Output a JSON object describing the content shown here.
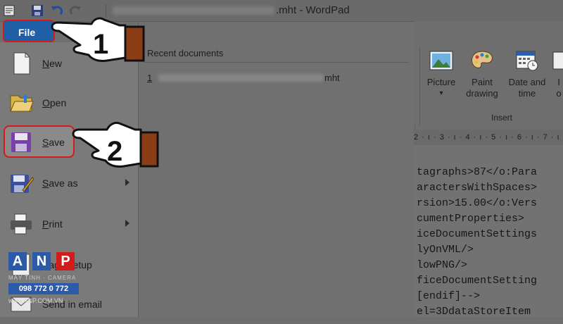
{
  "window": {
    "title_suffix": ".mht - WordPad"
  },
  "file_tab": {
    "label": "File"
  },
  "menu": {
    "items": [
      {
        "label_underline": "N",
        "label_rest": "ew"
      },
      {
        "label_underline": "O",
        "label_rest": "pen"
      },
      {
        "label_underline": "S",
        "label_rest": "ave"
      },
      {
        "label_underline": "S",
        "label_rest": "ave as"
      },
      {
        "label_underline": "P",
        "label_rest": "rint"
      },
      {
        "label_underline": "",
        "label_rest": "Page setup"
      },
      {
        "label_underline": "",
        "label_rest": "Send in email"
      }
    ]
  },
  "recent": {
    "title": "Recent documents",
    "items": [
      {
        "number": "1",
        "ext": "mht"
      }
    ]
  },
  "ribbon": {
    "buttons": [
      {
        "line1": "Picture",
        "line2": "▾"
      },
      {
        "line1": "Paint",
        "line2": "drawing"
      },
      {
        "line1": "Date and",
        "line2": "time"
      },
      {
        "line1": "I",
        "line2": "o"
      }
    ],
    "group_label": "Insert"
  },
  "ruler": {
    "text": "2 · ı · 3 · ı · 4 · ı · 5 · ı · 6 · ı · 7 · ı · 8"
  },
  "document": {
    "lines": [
      "tagraphs>87</o:Para",
      "aractersWithSpaces>",
      "rsion>15.00</o:Vers",
      "cumentProperties>",
      "iceDocumentSettings",
      "lyOnVML/>",
      "lowPNG/>",
      "ficeDocumentSetting",
      " [endif]-->",
      "el=3DdataStoreItem "
    ]
  },
  "steps": {
    "one": "1",
    "two": "2"
  },
  "watermark": {
    "letters": [
      "A",
      "N",
      "P"
    ],
    "subtitle": "MÁY TÍNH · CAMERA",
    "phone": "098 772 0 772",
    "site": "www.ANP.COM.VN"
  },
  "colors": {
    "file_tab": "#1f5fa6",
    "highlight": "#d21b1b"
  }
}
